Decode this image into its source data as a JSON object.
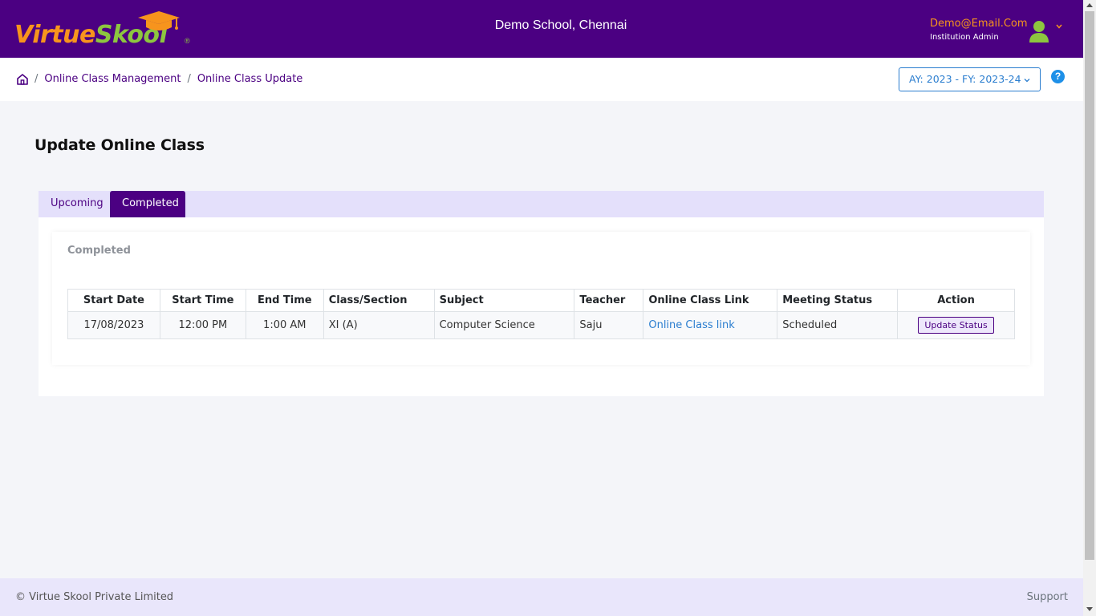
{
  "header": {
    "logo_part1": "Virtue",
    "logo_part2": "Skool",
    "logo_reg": "®",
    "school_name": "Demo School, Chennai",
    "user_email": "Demo@Email.Com",
    "user_role": "Institution Admin"
  },
  "breadcrumb": {
    "items": [
      "Online Class Management",
      "Online Class Update"
    ],
    "separator": "/"
  },
  "year_select": {
    "value": "AY: 2023 - FY: 2023-24"
  },
  "help": {
    "label": "?"
  },
  "page": {
    "title": "Update Online Class",
    "tabs": [
      {
        "label": "Upcoming",
        "active": false
      },
      {
        "label": "Completed",
        "active": true
      }
    ],
    "section_title": "Completed"
  },
  "table": {
    "columns": [
      "Start Date",
      "Start Time",
      "End Time",
      "Class/Section",
      "Subject",
      "Teacher",
      "Online Class Link",
      "Meeting Status",
      "Action"
    ],
    "rows": [
      {
        "start_date": "17/08/2023",
        "start_time": "12:00 PM",
        "end_time": "1:00 AM",
        "class_section": "XI (A)",
        "subject": "Computer Science",
        "teacher": "Saju",
        "link": "Online Class link",
        "status": "Scheduled",
        "action": "Update Status"
      }
    ]
  },
  "footer": {
    "copyright": "© Virtue Skool Private Limited",
    "support": "Support"
  },
  "colors": {
    "brand_purple": "#4b0082",
    "logo_orange": "#f7941d",
    "logo_green": "#8dc63f",
    "link_blue": "#2a7dcf"
  }
}
